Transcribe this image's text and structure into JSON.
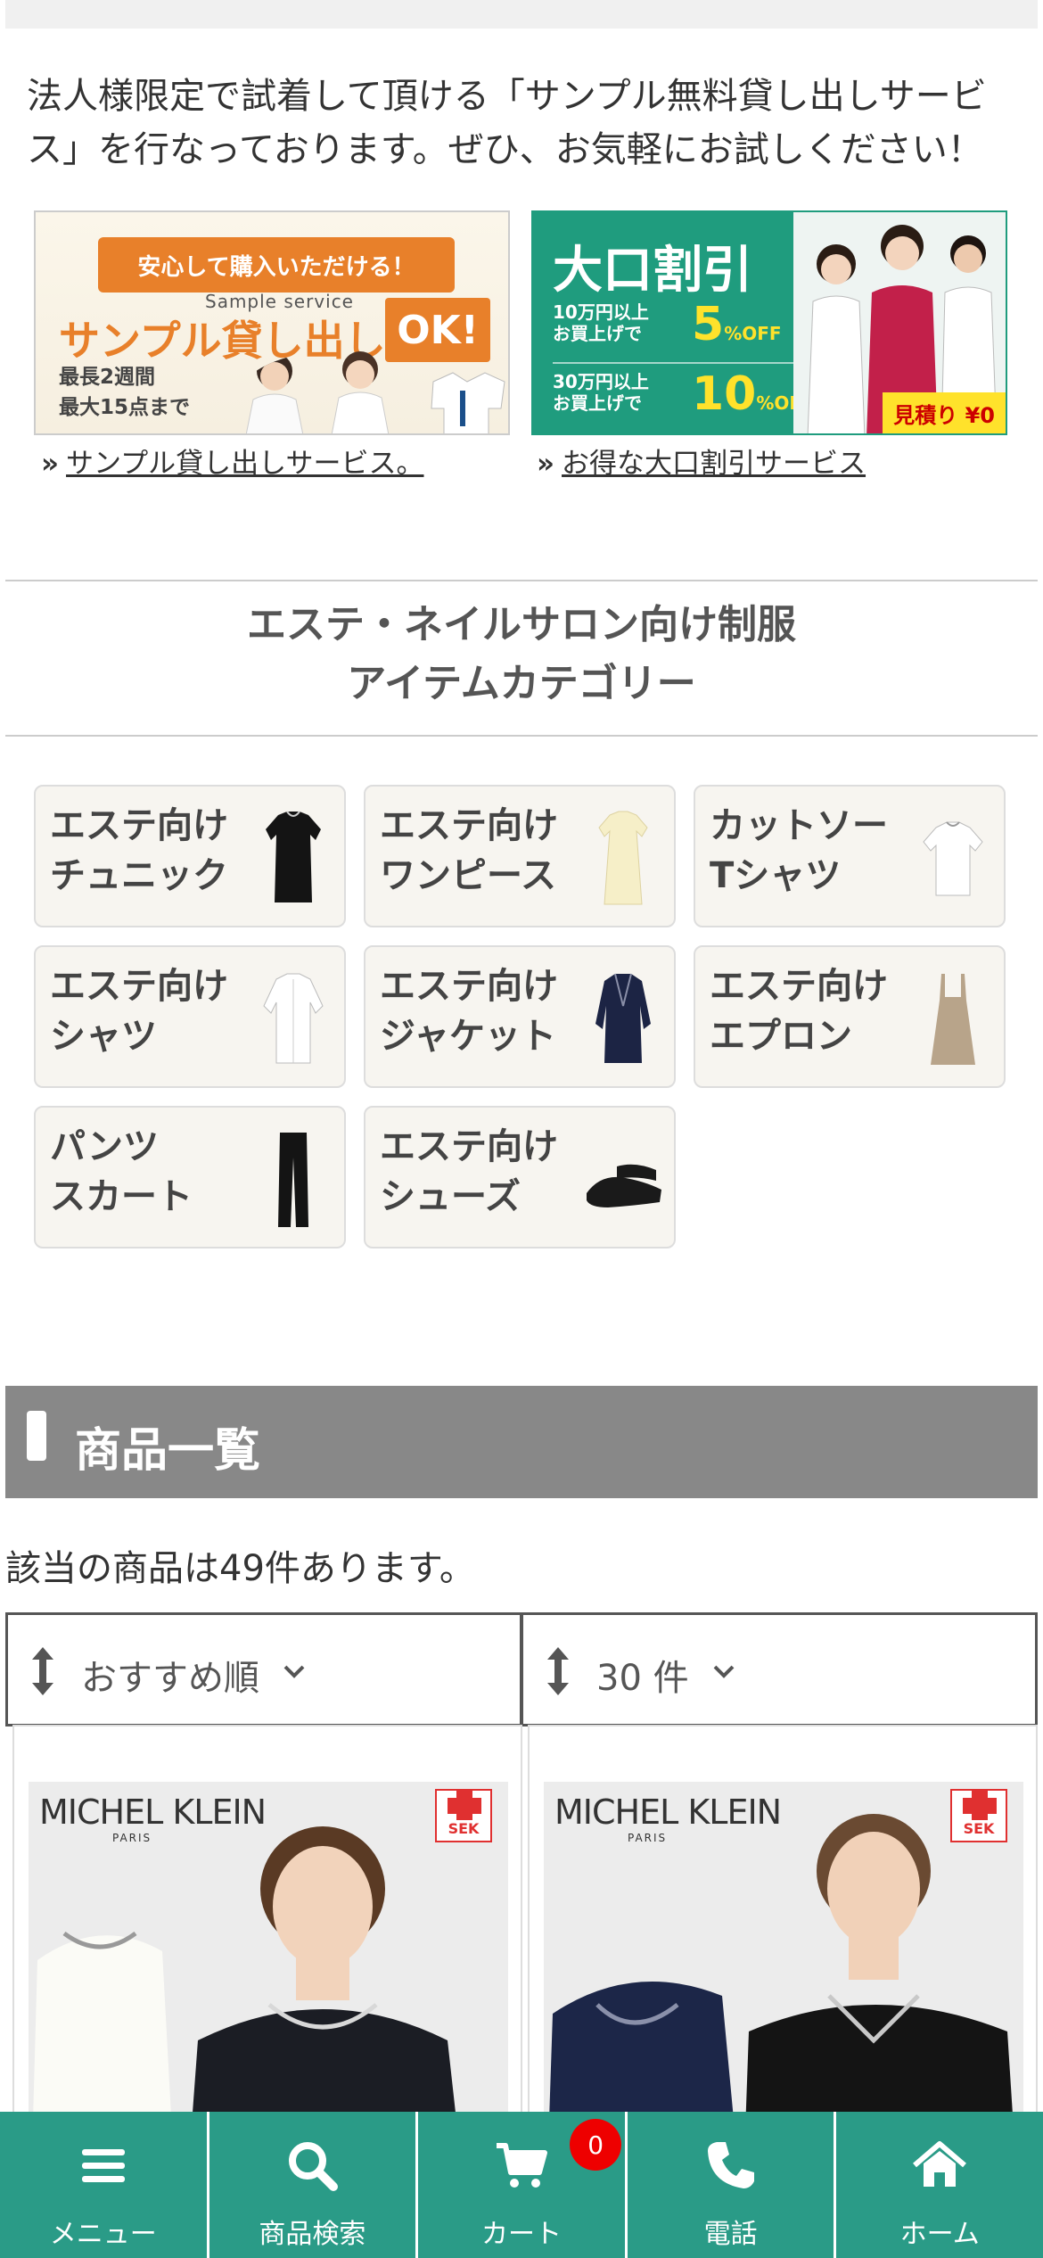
{
  "intro": {
    "text": "法人様限定で試着して頂ける「サンプル無料貸し出しサービス」を行なっております。ぜひ、お気軽にお試しください！"
  },
  "banners": [
    {
      "ribbon": "安心して購入いただける！",
      "sub": "Sample service",
      "main": "サンプル貸し出し",
      "badge": "OK!",
      "period_line1": "最長2週間",
      "period_line2": "最大15点まで",
      "link": "サンプル貸し出しサービス。"
    },
    {
      "title": "大口割引",
      "row1_line1": "10万円以上",
      "row1_line2": "お買上げで",
      "row1_off": "5",
      "row2_line1": "30万円以上",
      "row2_line2": "お買上げで",
      "row2_off": "10",
      "off_unit": "%",
      "off_word": "OFF",
      "estimate": "見積り ¥0",
      "link": "お得な大口割引サービス"
    }
  ],
  "category": {
    "heading_line1": "エステ・ネイルサロン向け制服",
    "heading_line2": "アイテムカテゴリー",
    "items": [
      {
        "label": "エステ向け\nチュニック",
        "icon": "black-tunic"
      },
      {
        "label": "エステ向け\nワンピース",
        "icon": "cream-dress"
      },
      {
        "label": "カットソー\nTシャツ",
        "icon": "white-tshirt"
      },
      {
        "label": "エステ向け\nシャツ",
        "icon": "white-shirt"
      },
      {
        "label": "エステ向け\nジャケット",
        "icon": "navy-jacket"
      },
      {
        "label": "エステ向け\nエプロン",
        "icon": "beige-apron"
      },
      {
        "label": "パンツ\nスカート",
        "icon": "black-pants"
      },
      {
        "label": "エステ向け\nシューズ",
        "icon": "black-sandals"
      }
    ]
  },
  "products_section": {
    "title": "商品一覧",
    "count_text": "該当の商品は49件あります。",
    "sort_value": "おすすめ順",
    "per_page_value": "30 件"
  },
  "products": [
    {
      "brand": "MICHEL KLEIN",
      "brand_sub": "PARIS",
      "badge": "SEK"
    },
    {
      "brand": "MICHEL KLEIN",
      "brand_sub": "PARIS",
      "badge": "SEK"
    }
  ],
  "bottom_nav": {
    "menu": "メニュー",
    "search": "商品検索",
    "cart": "カート",
    "cart_count": "0",
    "phone": "電話",
    "home": "ホーム"
  },
  "colors": {
    "accent_green": "#2a9b87",
    "banner_orange": "#e8802a",
    "section_gray": "#888888",
    "badge_red": "#e00000"
  }
}
